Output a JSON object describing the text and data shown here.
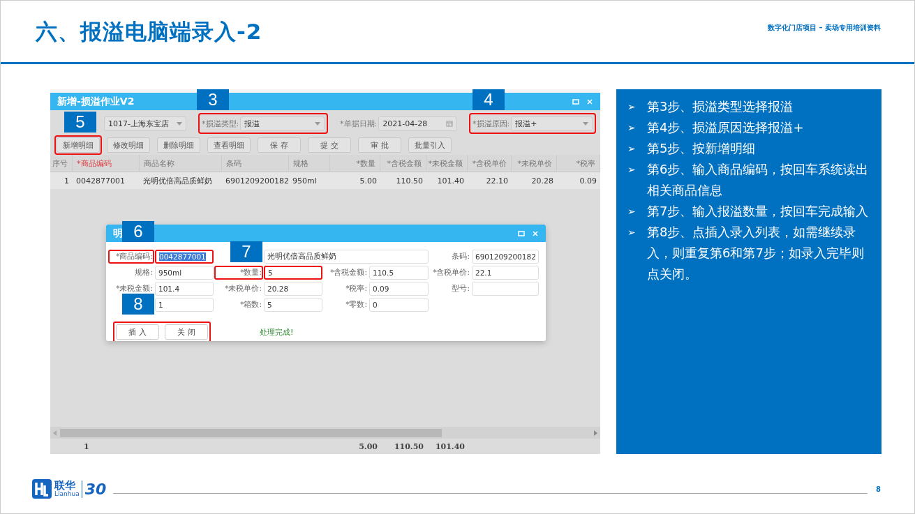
{
  "header": {
    "title": "六、报溢电脑端录入-2",
    "subtitle": "数字化门店项目 – 卖场专用培训资料"
  },
  "app_window": {
    "title": "新增-损溢作业V2",
    "fields": [
      {
        "value": "1017-上海东宝店",
        "kind": "select",
        "highlighted": false
      },
      {
        "label": "*损溢类型:",
        "value": "报溢",
        "kind": "select",
        "highlighted": true
      },
      {
        "label": "*单据日期:",
        "value": "2021-04-28",
        "kind": "date",
        "highlighted": false
      },
      {
        "label": "*损溢原因:",
        "value": "报溢+",
        "kind": "select",
        "highlighted": true
      }
    ],
    "buttons": [
      {
        "label": "新增明细",
        "highlighted": true
      },
      {
        "label": "修改明细",
        "highlighted": false
      },
      {
        "label": "删除明细",
        "highlighted": false
      },
      {
        "label": "查看明细",
        "highlighted": false
      },
      {
        "label": "保 存",
        "highlighted": false
      },
      {
        "label": "提 交",
        "highlighted": false
      },
      {
        "label": "审 批",
        "highlighted": false
      },
      {
        "label": "批量引入",
        "highlighted": false
      }
    ],
    "table": {
      "columns": [
        {
          "label": "序号",
          "emphasis": false
        },
        {
          "label": "*商品编码",
          "emphasis": true
        },
        {
          "label": "商品名称",
          "emphasis": false
        },
        {
          "label": "条码",
          "emphasis": false
        },
        {
          "label": "规格",
          "emphasis": false
        },
        {
          "label": "*数量",
          "emphasis": false
        },
        {
          "label": "*含税金额",
          "emphasis": false
        },
        {
          "label": "*未税金额",
          "emphasis": false
        },
        {
          "label": "*含税单价",
          "emphasis": false
        },
        {
          "label": "*未税单价",
          "emphasis": false
        },
        {
          "label": "*税率",
          "emphasis": false
        }
      ],
      "rows": [
        [
          "1",
          "0042877001",
          "光明优倍高品质鲜奶",
          "6901209200182",
          "950ml",
          "5.00",
          "110.50",
          "101.40",
          "22.10",
          "20.28",
          "0.09"
        ]
      ]
    },
    "totals": {
      "row_count": "1",
      "quantity": "5.00",
      "amount_with_tax": "110.50",
      "amount_without_tax": "101.40"
    }
  },
  "dialog": {
    "title": "明",
    "fields": [
      {
        "label": "*商品编码:",
        "value": "0042877001",
        "kind": "text",
        "highlighted": true,
        "text_selected": true
      },
      {
        "value": "光明优倍高品质鲜奶",
        "kind": "wide",
        "highlighted": false,
        "text_selected": false
      },
      {
        "label": "条码:",
        "value": "6901209200182",
        "kind": "text",
        "highlighted": false,
        "text_selected": false
      },
      {
        "label": "规格:",
        "value": "950ml",
        "kind": "text",
        "highlighted": false,
        "text_selected": false
      },
      {
        "label": "*数量:",
        "value": "5",
        "kind": "text",
        "highlighted": true,
        "text_selected": false
      },
      {
        "label": "*含税金额:",
        "value": "110.5",
        "kind": "text",
        "highlighted": false,
        "text_selected": false
      },
      {
        "label": "*含税单价:",
        "value": "22.1",
        "kind": "text",
        "highlighted": false,
        "text_selected": false
      },
      {
        "label": "*未税金额:",
        "value": "101.4",
        "kind": "text",
        "highlighted": false,
        "text_selected": false
      },
      {
        "label": "*未税单价:",
        "value": "20.28",
        "kind": "text",
        "highlighted": false,
        "text_selected": false
      },
      {
        "label": "*税率:",
        "value": "0.09",
        "kind": "text",
        "highlighted": false,
        "text_selected": false
      },
      {
        "label": "型号:",
        "kind": "text",
        "highlighted": false,
        "text_selected": false
      },
      {
        "value": "1",
        "kind": "text",
        "highlighted": false,
        "text_selected": false
      },
      {
        "label": "*箱数:",
        "value": "5",
        "kind": "text",
        "highlighted": false,
        "text_selected": false
      },
      {
        "label": "*零数:",
        "value": "0",
        "kind": "text",
        "highlighted": false,
        "text_selected": false
      }
    ],
    "buttons": [
      "插 入",
      "关 闭"
    ],
    "buttons_highlighted": true,
    "status": "处理完成!"
  },
  "callouts": [
    "3",
    "4",
    "5",
    "6",
    "7",
    "8"
  ],
  "steps": [
    "第3步、损溢类型选择报溢",
    "第4步、损溢原因选择报溢+",
    "第5步、按新增明细",
    "第6步、输入商品编码，按回车系统读出相关商品信息",
    "第7步、输入报溢数量，按回车完成输入",
    "第8步、点插入录入列表，如需继续录入，则重复第6和第7步；如录入完毕则点关闭。"
  ],
  "step_bullet": "➢",
  "footer": {
    "logo_text": "联华",
    "logo_subtext": "Lianhua",
    "anniversary": "30",
    "page": "8"
  }
}
